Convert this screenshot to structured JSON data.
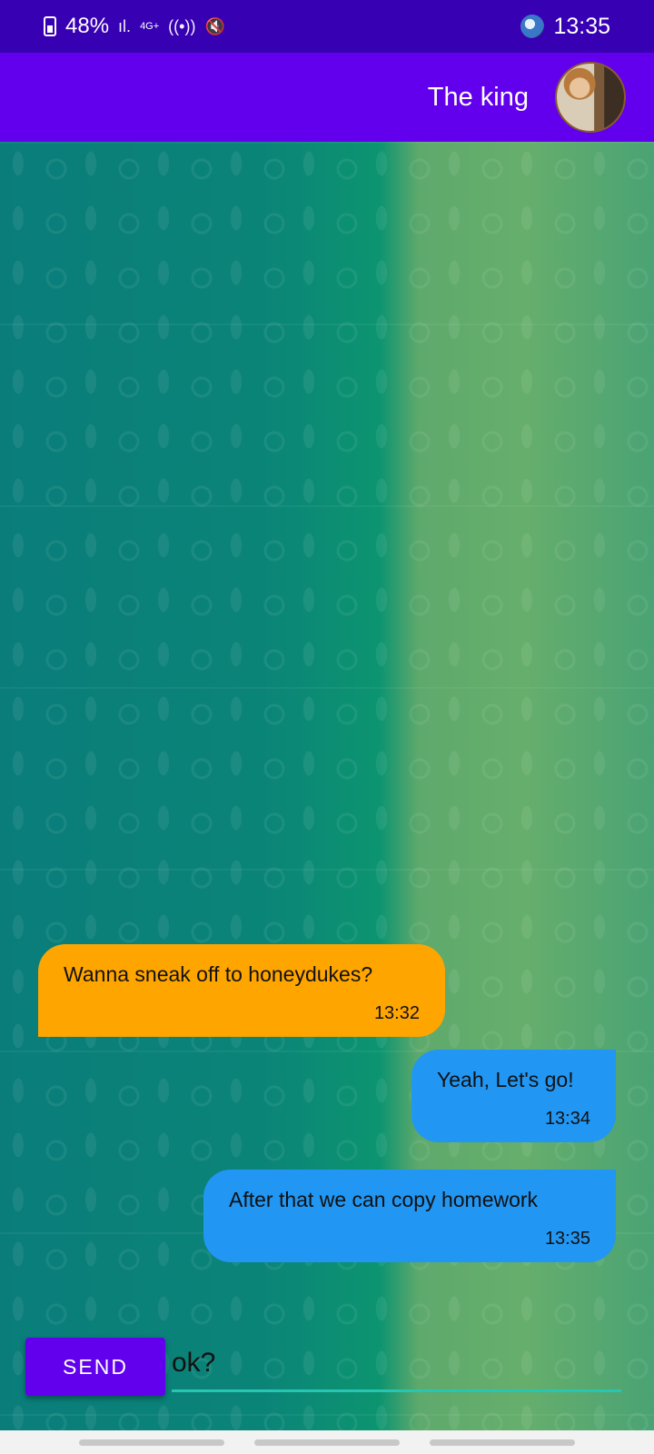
{
  "status_bar": {
    "battery": "48%",
    "network": "4G+",
    "time": "13:35"
  },
  "app_bar": {
    "title": "The king"
  },
  "messages": [
    {
      "text": "Wanna sneak off to honeydukes?",
      "time": "13:32",
      "direction": "incoming"
    },
    {
      "text": "Yeah, Let's go!",
      "time": "13:34",
      "direction": "outgoing"
    },
    {
      "text": "After that we can copy homework",
      "time": "13:35",
      "direction": "outgoing"
    }
  ],
  "composer": {
    "send_label": "SEND",
    "input_value": "ok?"
  },
  "colors": {
    "status_bar": "#3700b3",
    "app_bar": "#6200ee",
    "incoming_bubble": "#ffa500",
    "outgoing_bubble": "#2196f3",
    "input_underline": "#26c6b3"
  }
}
